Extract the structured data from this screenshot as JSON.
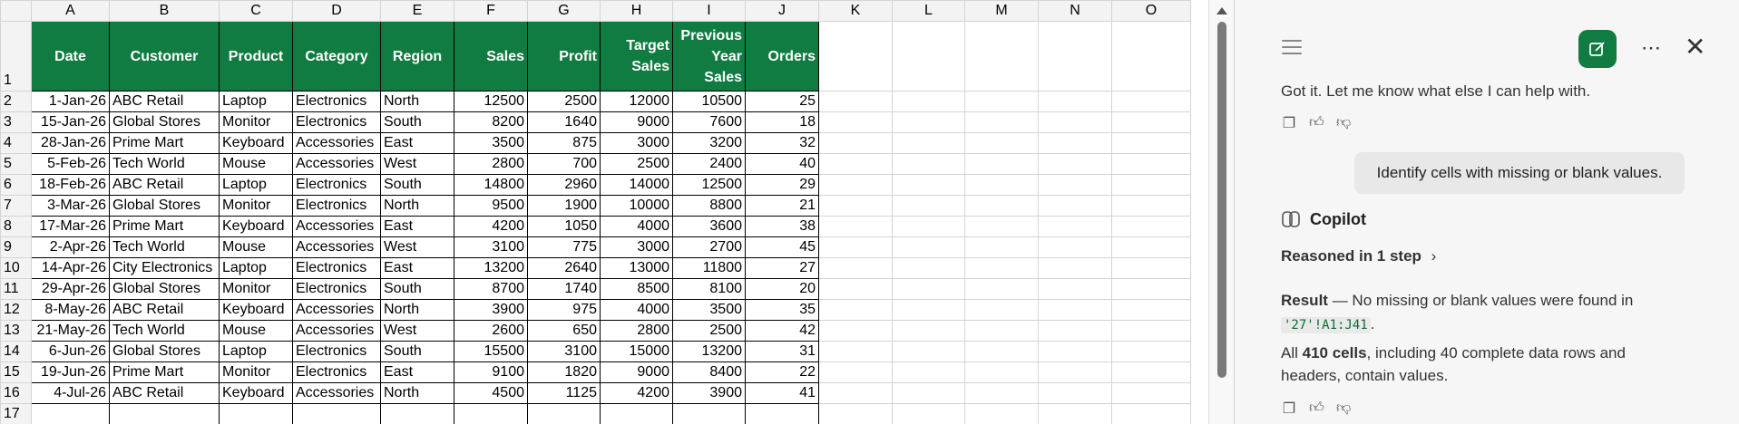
{
  "sheet": {
    "columns": [
      "A",
      "B",
      "C",
      "D",
      "E",
      "F",
      "G",
      "H",
      "I",
      "J",
      "K",
      "L",
      "M",
      "N",
      "O"
    ],
    "header_row": [
      "Date",
      "Customer",
      "Product",
      "Category",
      "Region",
      "Sales",
      "Profit",
      "Target Sales",
      "Previous Year Sales",
      "Orders"
    ],
    "rows": [
      [
        "1-Jan-26",
        "ABC Retail",
        "Laptop",
        "Electronics",
        "North",
        "12500",
        "2500",
        "12000",
        "10500",
        "25"
      ],
      [
        "15-Jan-26",
        "Global Stores",
        "Monitor",
        "Electronics",
        "South",
        "8200",
        "1640",
        "9000",
        "7600",
        "18"
      ],
      [
        "28-Jan-26",
        "Prime Mart",
        "Keyboard",
        "Accessories",
        "East",
        "3500",
        "875",
        "3000",
        "3200",
        "32"
      ],
      [
        "5-Feb-26",
        "Tech World",
        "Mouse",
        "Accessories",
        "West",
        "2800",
        "700",
        "2500",
        "2400",
        "40"
      ],
      [
        "18-Feb-26",
        "ABC Retail",
        "Laptop",
        "Electronics",
        "South",
        "14800",
        "2960",
        "14000",
        "12500",
        "29"
      ],
      [
        "3-Mar-26",
        "Global Stores",
        "Monitor",
        "Electronics",
        "North",
        "9500",
        "1900",
        "10000",
        "8800",
        "21"
      ],
      [
        "17-Mar-26",
        "Prime Mart",
        "Keyboard",
        "Accessories",
        "East",
        "4200",
        "1050",
        "4000",
        "3600",
        "38"
      ],
      [
        "2-Apr-26",
        "Tech World",
        "Mouse",
        "Accessories",
        "West",
        "3100",
        "775",
        "3000",
        "2700",
        "45"
      ],
      [
        "14-Apr-26",
        "City Electronics",
        "Laptop",
        "Electronics",
        "East",
        "13200",
        "2640",
        "13000",
        "11800",
        "27"
      ],
      [
        "29-Apr-26",
        "Global Stores",
        "Monitor",
        "Electronics",
        "South",
        "8700",
        "1740",
        "8500",
        "8100",
        "20"
      ],
      [
        "8-May-26",
        "ABC Retail",
        "Keyboard",
        "Accessories",
        "North",
        "3900",
        "975",
        "4000",
        "3500",
        "35"
      ],
      [
        "21-May-26",
        "Tech World",
        "Mouse",
        "Accessories",
        "West",
        "2600",
        "650",
        "2800",
        "2500",
        "42"
      ],
      [
        "6-Jun-26",
        "Global Stores",
        "Laptop",
        "Electronics",
        "South",
        "15500",
        "3100",
        "15000",
        "13200",
        "31"
      ],
      [
        "19-Jun-26",
        "Prime Mart",
        "Monitor",
        "Electronics",
        "East",
        "9100",
        "1820",
        "9000",
        "8400",
        "22"
      ],
      [
        "4-Jul-26",
        "ABC Retail",
        "Keyboard",
        "Accessories",
        "North",
        "4500",
        "1125",
        "4200",
        "3900",
        "41"
      ]
    ],
    "partial_row_number": "17",
    "accent_color": "#107c41"
  },
  "copilot": {
    "previous_reply": "Got it. Let me know what else I can help with.",
    "user_message": "Identify cells with missing or blank values.",
    "assistant_name": "Copilot",
    "reasoned_label": "Reasoned in 1 step",
    "result_label": "Result",
    "result_text": " — No missing or blank values were found in",
    "range_ref": "'27'!A1:J41",
    "result_period": ".",
    "summary_prefix": "All ",
    "summary_bold": "410 cells",
    "summary_line1_rest": ", including 40 complete data rows and",
    "summary_line2": "headers, contain values.",
    "icons": [
      "copy-icon",
      "thumbs-up-icon",
      "thumbs-down-icon",
      "hamburger-icon",
      "new-chat-icon",
      "more-icon",
      "close-icon",
      "copilot-logo-icon"
    ]
  }
}
